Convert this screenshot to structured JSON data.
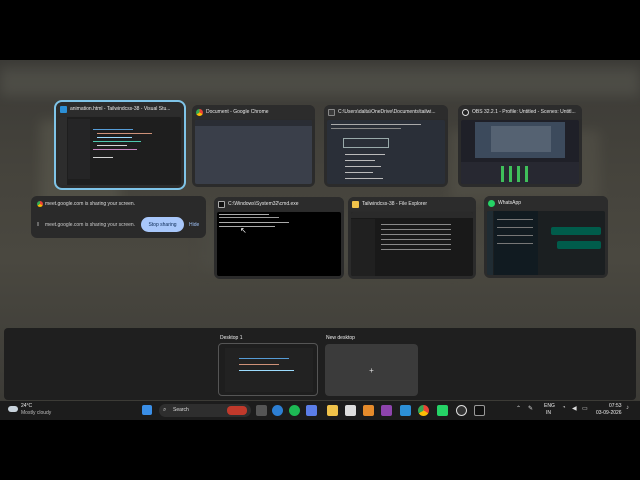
{
  "windows": [
    {
      "title": "animation.html - Tailwindcss-38 - Visual Stu...",
      "selected": true
    },
    {
      "title": "Document - Google Chrome",
      "selected": false
    },
    {
      "title": "C:\\Users\\dalta\\OneDrive\\Documents\\tailwi...",
      "selected": false
    },
    {
      "title": "OBS 32.2.1 - Profile: Untitled - Scenes: Untitl...",
      "selected": false
    },
    {
      "title": "C:\\Windows\\System32\\cmd.exe",
      "selected": false
    },
    {
      "title": "Tailwindcss-38 - File Explorer",
      "selected": false
    },
    {
      "title": "WhatsApp",
      "selected": false
    }
  ],
  "share_bar": {
    "url_title": "meet.google.com is sharing your screen.",
    "message": "meet.google.com is sharing your screen.",
    "stop_label": "Stop sharing",
    "hide_label": "Hide"
  },
  "desktops": {
    "current": "Desktop 1",
    "new": "New desktop",
    "new_symbol": "+"
  },
  "taskbar": {
    "weather_temp": "24°C",
    "weather_desc": "Mostly cloudy",
    "search_label": "Search",
    "lang_top": "ENG",
    "lang_bottom": "IN",
    "time": "07:53",
    "date": "03-09-2026"
  },
  "colors": {
    "accent_selected": "#7fc4e8",
    "stop_button": "#a8c7fa"
  }
}
